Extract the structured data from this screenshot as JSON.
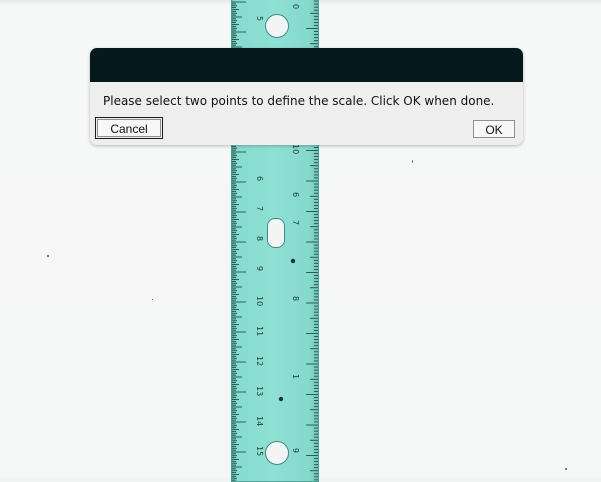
{
  "dialog": {
    "message": "Please select two points to define the scale. Click OK when done.",
    "cancel_label": "Cancel",
    "ok_label": "OK"
  },
  "ruler": {
    "inch_labels": [
      "5",
      "6",
      "7",
      "8",
      "9",
      "10",
      "11",
      "12",
      "13",
      "14",
      "15"
    ],
    "cm_labels": [
      "0",
      "10",
      "6",
      "7",
      "8",
      "1",
      "9"
    ],
    "color": "#8fe0d4"
  }
}
